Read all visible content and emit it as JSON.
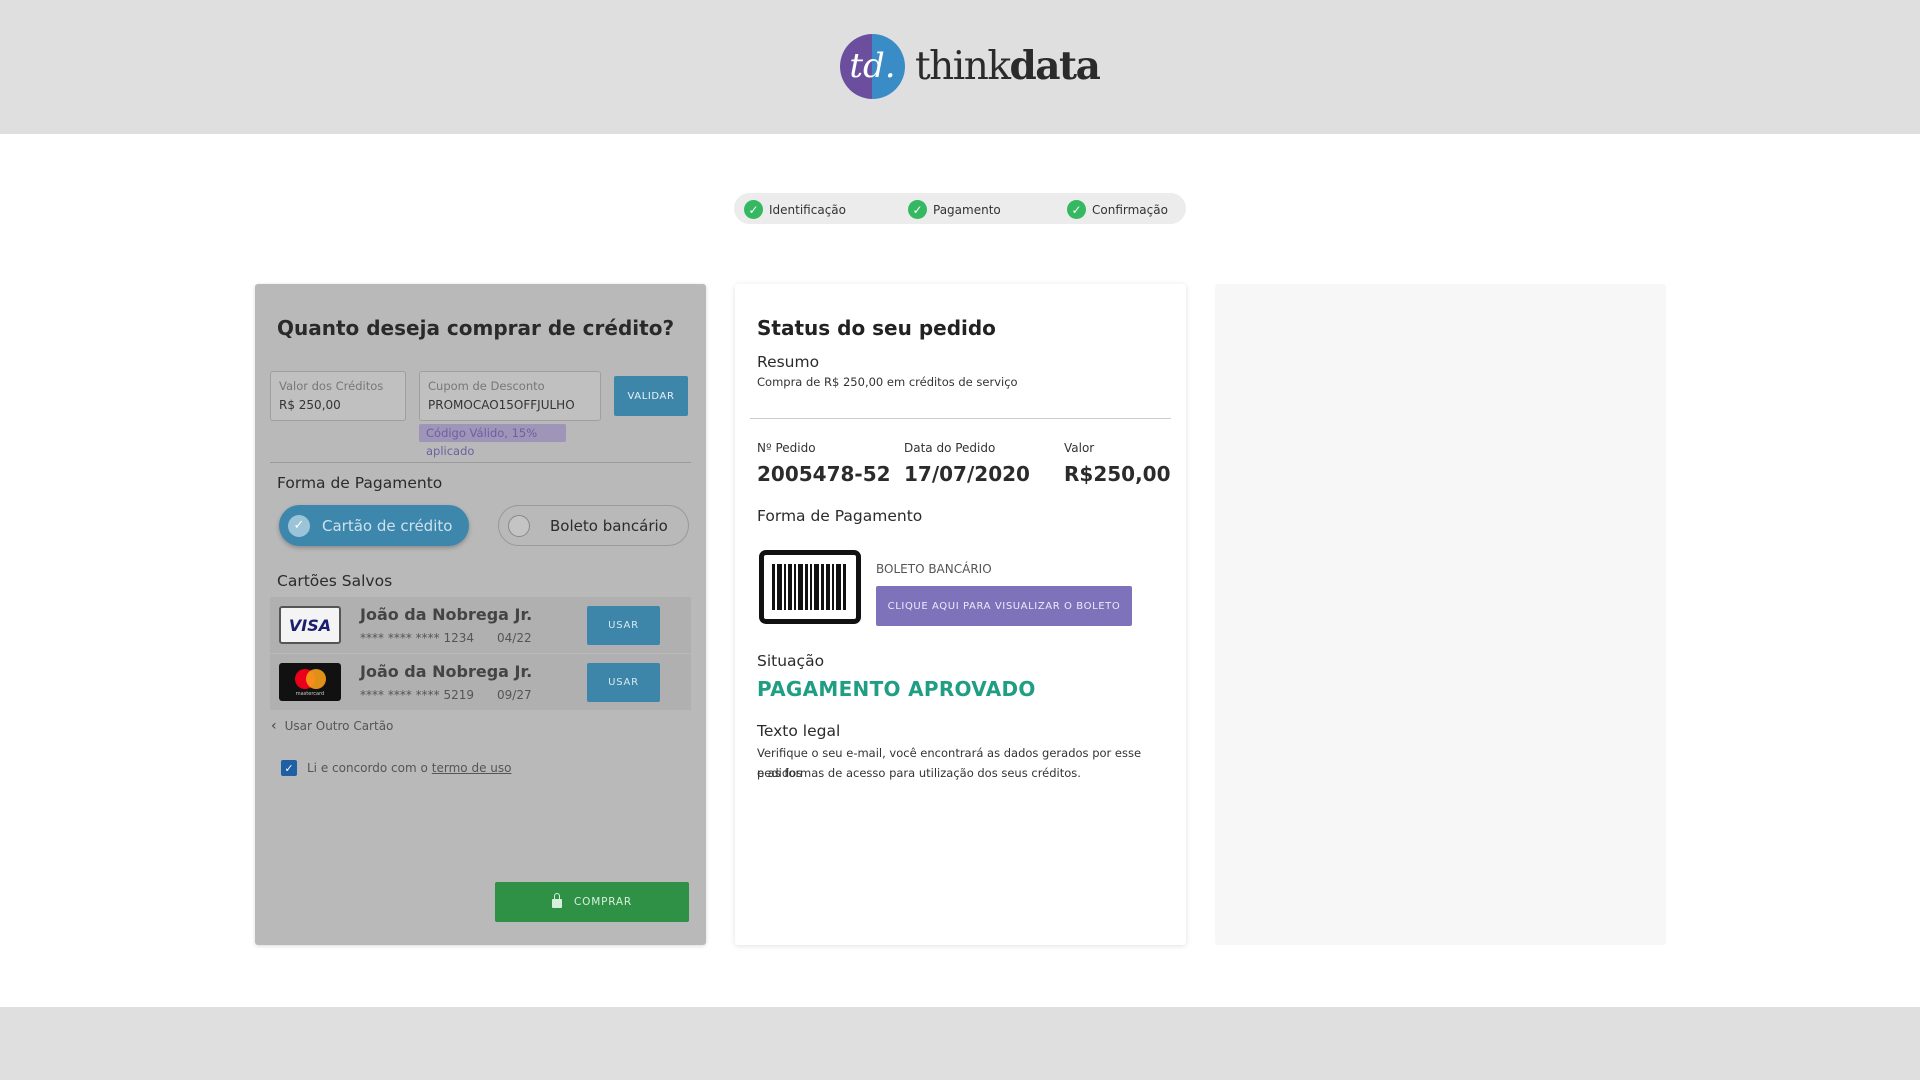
{
  "brand": {
    "logo_mark": "td.",
    "name_light": "think",
    "name_bold": "data"
  },
  "stepper": [
    {
      "label": "Identificação",
      "icon": "check-icon"
    },
    {
      "label": "Pagamento",
      "icon": "check-icon"
    },
    {
      "label": "Confirmação",
      "icon": "check-icon"
    }
  ],
  "purchase": {
    "title": "Quanto deseja comprar de crédito?",
    "credits_label": "Valor dos Créditos",
    "credits_value": "R$ 250,00",
    "coupon_label": "Cupom de Desconto",
    "coupon_value": "PROMOCAO15OFFJULHO",
    "validate_button": "VALIDAR",
    "coupon_hint": "Código Válido, 15% aplicado",
    "payment_section": "Forma de Pagamento",
    "payment_options": {
      "card": "Cartão de crédito",
      "boleto": "Boleto bancário",
      "selected": "card"
    },
    "saved_cards_section": "Cartões Salvos",
    "saved_cards": [
      {
        "brand": "VISA",
        "name": "João da Nobrega Jr.",
        "number": "**** **** **** 1234",
        "expiry": "04/22",
        "action": "USAR"
      },
      {
        "brand": "mastercard",
        "name": "João da Nobrega Jr.",
        "number": "**** **** **** 5219",
        "expiry": "09/27",
        "action": "USAR"
      }
    ],
    "other_card": "Usar Outro Cartão",
    "terms_text": "Li e concordo com o",
    "terms_link": "termo de uso",
    "terms_checked": true,
    "buy_button": "COMPRAR"
  },
  "order": {
    "title": "Status do seu pedido",
    "summary_heading": "Resumo",
    "summary_text": "Compra de R$ 250,00 em créditos de serviço",
    "order_number_label": "Nº Pedido",
    "order_number": "2005478-52",
    "order_date_label": "Data do Pedido",
    "order_date": "17/07/2020",
    "amount_label": "Valor",
    "amount": "R$250,00",
    "payment_heading": "Forma de Pagamento",
    "payment_method": "BOLETO BANCÁRIO",
    "boleto_button": "CLIQUE AQUI PARA VISUALIZAR O BOLETO",
    "status_heading": "Situação",
    "status": "PAGAMENTO APROVADO",
    "legal_heading": "Texto legal",
    "legal_line1": "Verifique o seu e-mail, você encontrará as dados gerados por esse pedidos",
    "legal_line2": "e as formas de acesso para utilização dos seus créditos."
  },
  "colors": {
    "accent_blue": "#3d85a9",
    "approved_green": "#1f9e83",
    "buy_green": "#2e9145",
    "boleto_purple": "#7e72bb"
  }
}
